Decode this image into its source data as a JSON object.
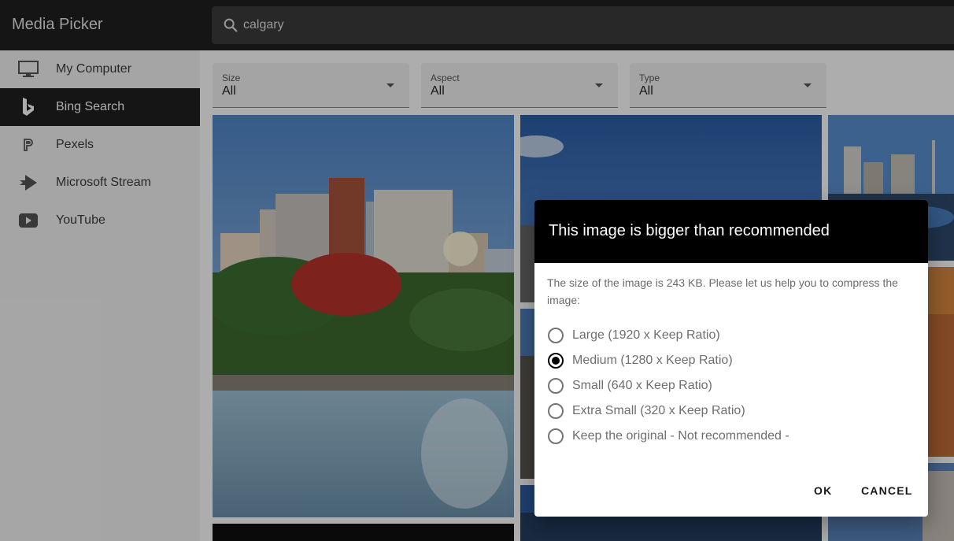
{
  "app": {
    "title": "Media Picker"
  },
  "search": {
    "value": "calgary",
    "icon": "search-icon"
  },
  "sidebar": {
    "items": [
      {
        "label": "My Computer",
        "icon": "monitor-icon",
        "active": false
      },
      {
        "label": "Bing Search",
        "icon": "bing-icon",
        "active": true
      },
      {
        "label": "Pexels",
        "icon": "pexels-icon",
        "active": false
      },
      {
        "label": "Microsoft Stream",
        "icon": "stream-icon",
        "active": false
      },
      {
        "label": "YouTube",
        "icon": "youtube-icon",
        "active": false
      }
    ]
  },
  "filters": [
    {
      "label": "Size",
      "value": "All"
    },
    {
      "label": "Aspect",
      "value": "All"
    },
    {
      "label": "Type",
      "value": "All"
    }
  ],
  "dialog": {
    "title": "This image is bigger than recommended",
    "message": "The size of the image is 243 KB. Please let us help you to compress the image:",
    "options": [
      {
        "label": "Large (1920 x Keep Ratio)",
        "checked": false
      },
      {
        "label": "Medium (1280 x Keep Ratio)",
        "checked": true
      },
      {
        "label": "Small (640 x Keep Ratio)",
        "checked": false
      },
      {
        "label": "Extra Small (320 x Keep Ratio)",
        "checked": false
      },
      {
        "label": "Keep the original - Not recommended -",
        "checked": false
      }
    ],
    "ok_label": "OK",
    "cancel_label": "CANCEL"
  },
  "colors": {
    "topbar": "#1f1f1f",
    "active_item": "#1f1f1f",
    "dialog_header": "#000000",
    "accent": "#000000"
  }
}
